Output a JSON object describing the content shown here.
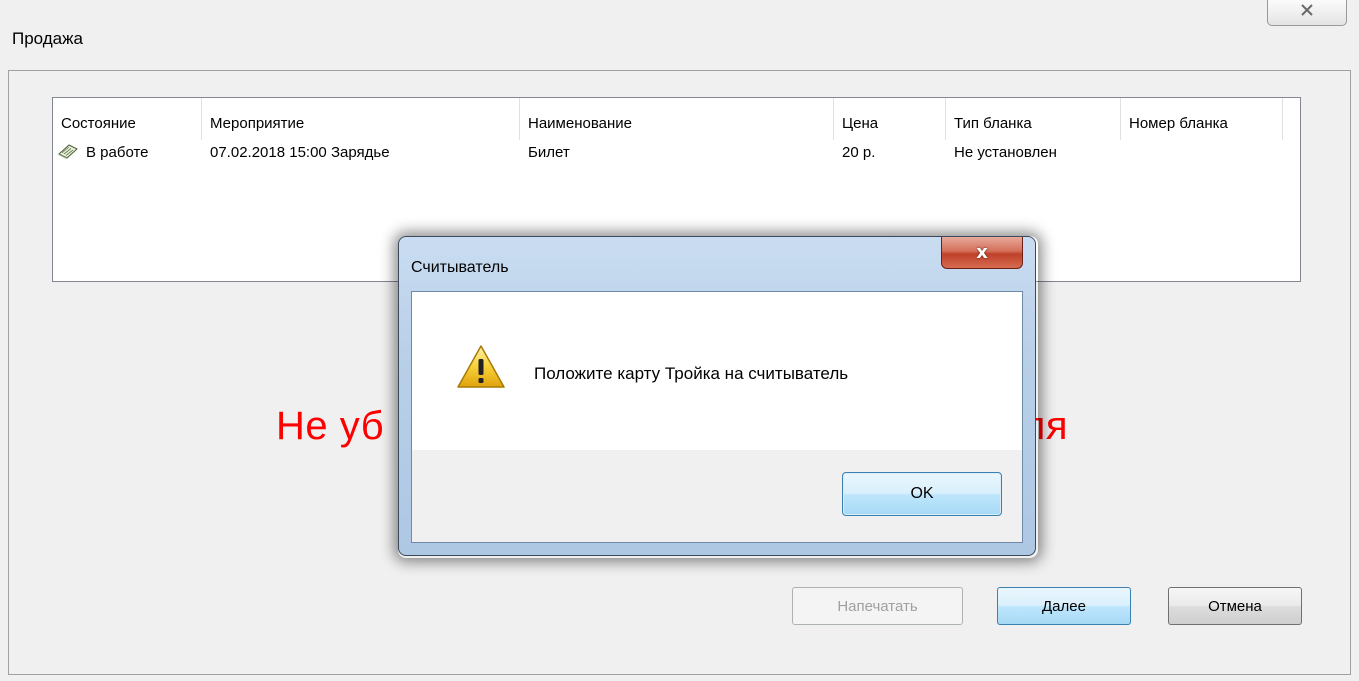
{
  "window": {
    "title": "Продажа",
    "close_symbol": "✕"
  },
  "grid": {
    "columns": [
      "Состояние",
      "Мероприятие",
      "Наименование",
      "Цена",
      "Тип бланка",
      "Номер бланка"
    ],
    "rows": [
      {
        "status_icon": "ticket-note-icon",
        "status": "В работе",
        "event": "07.02.2018 15:00 Зарядье",
        "name": "Билет",
        "price": "20 р.",
        "blank_type": "Не установлен",
        "blank_number": ""
      }
    ]
  },
  "background_message_left": "Не уб",
  "background_message_right": "ля",
  "buttons": {
    "print": "Напечатать",
    "next": "Далее",
    "cancel": "Отмена"
  },
  "dialog": {
    "title": "Считыватель",
    "close_symbol": "x",
    "icon": "warning-icon",
    "message": "Положите карту Тройка на считыватель",
    "ok": "OK"
  },
  "colors": {
    "warning_red": "#ff0000",
    "dialog_frame": "#b8cfe8",
    "close_red": "#c0412a"
  }
}
